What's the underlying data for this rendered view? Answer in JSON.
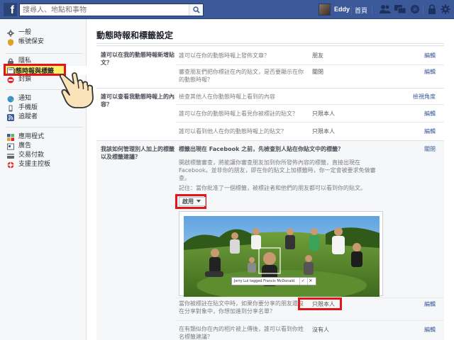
{
  "topbar": {
    "logo": "f",
    "search_placeholder": "搜尋人、地點和事物",
    "user_name": "Eddy",
    "home_label": "首頁"
  },
  "leftnav": {
    "groups": [
      {
        "items": [
          {
            "label": "一般",
            "icon": "gear-icon"
          },
          {
            "label": "帳號保安",
            "icon": "shield-icon"
          }
        ]
      },
      {
        "items": [
          {
            "label": "隱私",
            "icon": "lock-icon"
          },
          {
            "label": "動態時報與標籤",
            "icon": "timeline-icon",
            "active": true
          },
          {
            "label": "封鎖",
            "icon": "block-icon"
          }
        ]
      },
      {
        "items": [
          {
            "label": "通知",
            "icon": "globe-icon"
          },
          {
            "label": "手機版",
            "icon": "mobile-icon"
          },
          {
            "label": "追蹤者",
            "icon": "rss-icon"
          }
        ]
      },
      {
        "items": [
          {
            "label": "應用程式",
            "icon": "apps-icon"
          },
          {
            "label": "廣告",
            "icon": "ads-icon"
          },
          {
            "label": "交易付款",
            "icon": "payment-icon"
          },
          {
            "label": "支援主控板",
            "icon": "support-icon"
          }
        ]
      }
    ]
  },
  "main": {
    "title": "動態時報和標籤設定",
    "sections": [
      {
        "label": "誰可以在我的動態時報新增貼文？",
        "rows": [
          {
            "question": "誰可以在你的動態時報上發佈文章？",
            "value": "朋友",
            "action": "編輯"
          },
          {
            "question": "審查朋友們把你標註在內的貼文，是否要顯示在你的動態時報？",
            "value": "關閉",
            "action": "編輯"
          }
        ]
      },
      {
        "label": "誰可以查看我動態時報上的內容？",
        "rows": [
          {
            "question": "檢查其他人在你動態時報上看到的內容",
            "value": "",
            "action": "檢視角度"
          },
          {
            "question": "誰可以在你的動態時報上看見你被標註的貼文？",
            "value": "只限本人",
            "action": "編輯"
          },
          {
            "question": "誰可以看到他人在你的動態時報上的貼文？",
            "value": "只限本人",
            "action": "編輯"
          }
        ]
      },
      {
        "label": "我該如何管理別人加上的標籤以及標籤建議？",
        "expanded": {
          "title": "標籤出現在 Facebook 之前，先檢查別人貼在你貼文中的標籤？",
          "action": "關閉",
          "body": "開啟標籤審查，將能讓你審查朋友加到你所發佈內容的標籤，直接出現在 Facebook。並非你的朋友，即在你的貼文上加標籤時，你一定會被要求免做審查。",
          "note": "記住：當你批准了一個標籤，被標註者和他們的朋友都可以看到你的貼文。",
          "dropdown_label": "啟用",
          "photo_tag_text": "Jerry Lui tagged Francis McDonald.",
          "photo_tag_confirm": "✓",
          "photo_tag_cancel": "✕"
        },
        "rows": [
          {
            "question": "當你被標註在貼文中時，如果你要分享的朋友還沒在分享對象中，你想加進到分享名單？",
            "value": "只限本人",
            "action": "編輯"
          },
          {
            "question": "在有類似你在內的相片被上傳後，誰可以看到你姓名標籤建議？",
            "value": "沒有人",
            "action": "編輯"
          }
        ]
      }
    ]
  },
  "colors": {
    "brand": "#3b5998",
    "highlight_red": "#e3151b",
    "highlight_yellow": "#ffef6b",
    "link": "#3b5998"
  }
}
